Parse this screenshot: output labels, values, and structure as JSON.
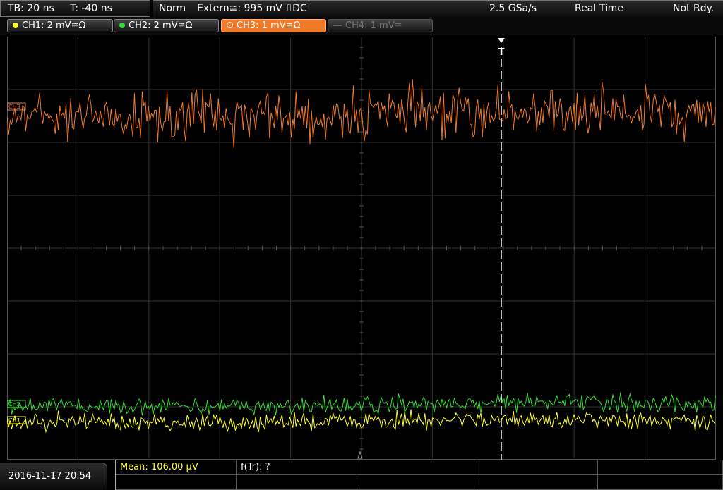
{
  "header": {
    "tb": "TB: 20 ns",
    "trigger_time": "T: -40 ns",
    "mode": "Norm",
    "trigger_source": "Extern≅: 995 mV ⎍DC",
    "sample_rate": "2.5 GSa/s",
    "acq_mode": "Real Time",
    "status": "Not Rdy."
  },
  "channels": [
    {
      "label": "CH1: 2 mV≅Ω",
      "color": "#ffff33",
      "active": false
    },
    {
      "label": "CH2: 2 mV≅Ω",
      "color": "#33dd33",
      "active": false
    },
    {
      "label": "CH3: 1 mV≅Ω",
      "color": "#f07a2a",
      "active": true
    },
    {
      "label": "CH4: 1 mV≅",
      "color": "#777777",
      "active": false
    }
  ],
  "plot": {
    "trigger_marker": "T",
    "channel_markers": [
      "CH3",
      "CH2",
      "CH1"
    ],
    "colors": {
      "grid": "#333333",
      "ch1": "#ffff33",
      "ch2": "#33dd33",
      "ch3": "#f07a2a",
      "trigger": "#ffffff"
    }
  },
  "footer": {
    "datetime": "2016-11-17 20:54",
    "mean": "Mean: 106.00 µV",
    "ftr": "f(Tr): ?"
  }
}
